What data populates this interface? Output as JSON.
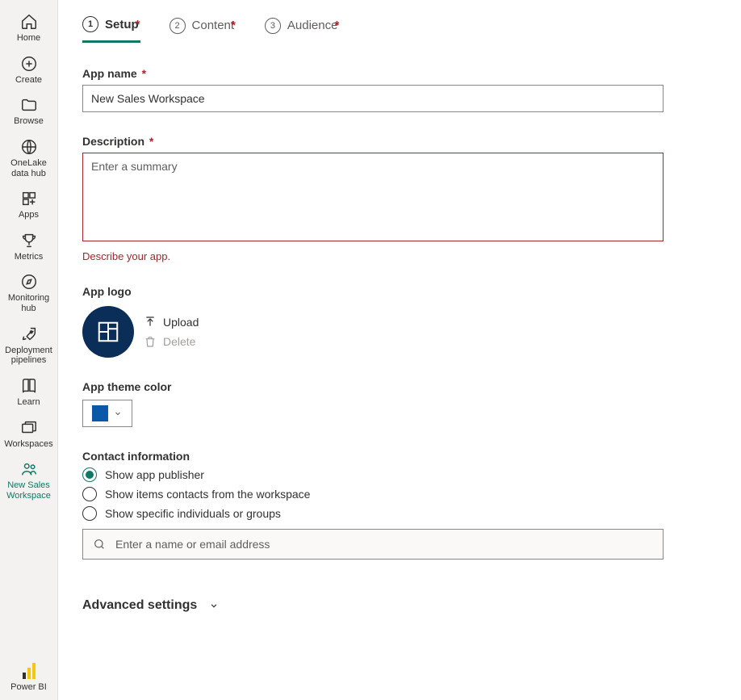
{
  "rail": {
    "home": "Home",
    "create": "Create",
    "browse": "Browse",
    "onelake": "OneLake data hub",
    "apps": "Apps",
    "metrics": "Metrics",
    "monitoring": "Monitoring hub",
    "pipelines": "Deployment pipelines",
    "learn": "Learn",
    "workspaces": "Workspaces",
    "sales": "New Sales Workspace",
    "powerbi": "Power BI"
  },
  "tabs": {
    "setup_num": "1",
    "setup": "Setup",
    "content_num": "2",
    "content": "Content",
    "audience_num": "3",
    "audience": "Audience"
  },
  "form": {
    "appname_label": "App name",
    "appname_value": "New Sales Workspace",
    "description_label": "Description",
    "description_placeholder": "Enter a summary",
    "description_error": "Describe your app.",
    "applogo_label": "App logo",
    "upload": "Upload",
    "delete": "Delete",
    "theme_label": "App theme color",
    "theme_color": "#0b57a8",
    "contact_label": "Contact information",
    "contact_opt1": "Show app publisher",
    "contact_opt2": "Show items contacts from the workspace",
    "contact_opt3": "Show specific individuals or groups",
    "contact_placeholder": "Enter a name or email address",
    "advanced": "Advanced settings"
  }
}
